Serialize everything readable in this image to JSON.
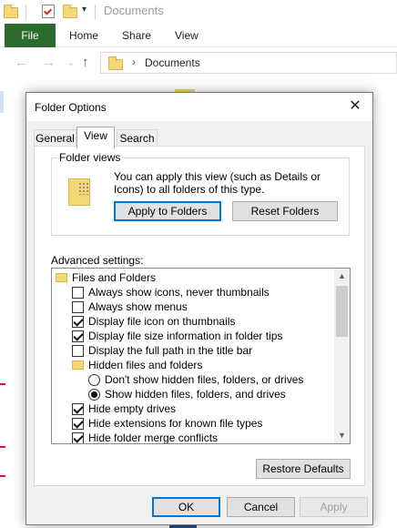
{
  "explorer": {
    "title": "Documents",
    "ribbon_tabs": [
      "File",
      "Home",
      "Share",
      "View"
    ],
    "breadcrumb": "Documents"
  },
  "dialog": {
    "title": "Folder Options",
    "tabs": [
      "General",
      "View",
      "Search"
    ],
    "active_tab": "View",
    "folder_views": {
      "legend": "Folder views",
      "description": "You can apply this view (such as Details or Icons) to all folders of this type.",
      "apply_button": "Apply to Folders",
      "reset_button": "Reset Folders"
    },
    "advanced_label": "Advanced settings:",
    "advanced_items": [
      {
        "type": "folder",
        "label": "Files and Folders",
        "indent": 0
      },
      {
        "type": "checkbox",
        "label": "Always show icons, never thumbnails",
        "checked": false,
        "indent": 1
      },
      {
        "type": "checkbox",
        "label": "Always show menus",
        "checked": false,
        "indent": 1
      },
      {
        "type": "checkbox",
        "label": "Display file icon on thumbnails",
        "checked": true,
        "indent": 1
      },
      {
        "type": "checkbox",
        "label": "Display file size information in folder tips",
        "checked": true,
        "indent": 1
      },
      {
        "type": "checkbox",
        "label": "Display the full path in the title bar",
        "checked": false,
        "indent": 1
      },
      {
        "type": "folder",
        "label": "Hidden files and folders",
        "indent": 1
      },
      {
        "type": "radio",
        "label": "Don't show hidden files, folders, or drives",
        "checked": false,
        "indent": 2
      },
      {
        "type": "radio",
        "label": "Show hidden files, folders, and drives",
        "checked": true,
        "indent": 2
      },
      {
        "type": "checkbox",
        "label": "Hide empty drives",
        "checked": true,
        "indent": 1
      },
      {
        "type": "checkbox",
        "label": "Hide extensions for known file types",
        "checked": true,
        "indent": 1
      },
      {
        "type": "checkbox",
        "label": "Hide folder merge conflicts",
        "checked": true,
        "indent": 1
      }
    ],
    "restore_button": "Restore Defaults",
    "ok_button": "OK",
    "cancel_button": "Cancel",
    "apply_button": "Apply"
  },
  "colors": {
    "file_tab": "#2b6b2e",
    "focus_border": "#0078d7",
    "folder_yellow": "#f6d776"
  }
}
